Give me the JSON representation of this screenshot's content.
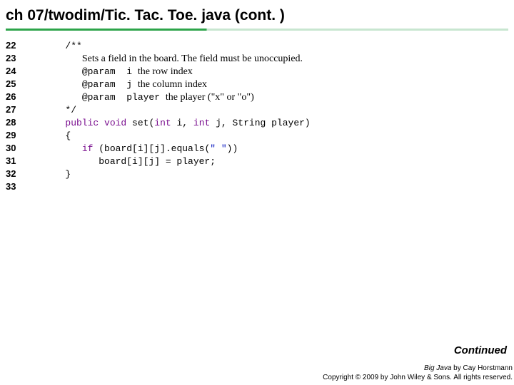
{
  "title": "ch 07/twodim/Tic. Tac. Toe. java (cont. )",
  "gutter": [
    "22",
    "23",
    "24",
    "25",
    "26",
    "27",
    "28",
    "29",
    "30",
    "31",
    "32",
    "33"
  ],
  "code": {
    "l22": "   /**",
    "l23_pre": "      ",
    "l23_txt": "Sets a field in the board. The field must be unoccupied.",
    "l24_pre": "      ",
    "l24_tag": "@param  i ",
    "l24_txt": "the row index",
    "l25_pre": "      ",
    "l25_tag": "@param  j ",
    "l25_txt": "the column index",
    "l26_pre": "      ",
    "l26_tag": "@param  player ",
    "l26_txt": "the player (\"x\" or \"o\")",
    "l27": "   */",
    "l28_a": "   ",
    "l28_kw1": "public",
    "l28_b": " ",
    "l28_kw2": "void",
    "l28_c": " set(",
    "l28_kw3": "int",
    "l28_d": " i, ",
    "l28_kw4": "int",
    "l28_e": " j, String player)",
    "l29": "   {",
    "l30_a": "      ",
    "l30_kw": "if",
    "l30_b": " (board[i][j].equals(",
    "l30_str": "\" \"",
    "l30_c": "))",
    "l31": "         board[i][j] = player;",
    "l32": "   }",
    "l33": ""
  },
  "continued": "Continued",
  "footer": {
    "line1a": "Big Java",
    "line1b": " by  Cay Horstmann",
    "line2": "Copyright © 2009 by John Wiley & Sons.  All rights reserved."
  }
}
